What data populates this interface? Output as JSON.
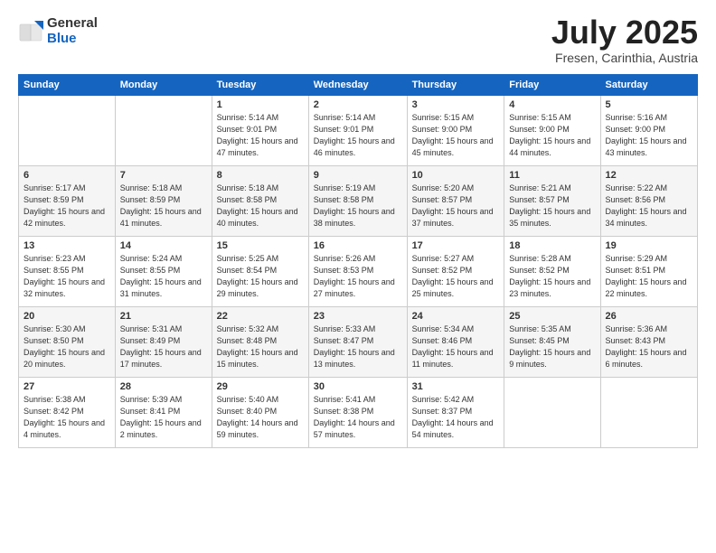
{
  "logo": {
    "general": "General",
    "blue": "Blue"
  },
  "title": "July 2025",
  "subtitle": "Fresen, Carinthia, Austria",
  "days_header": [
    "Sunday",
    "Monday",
    "Tuesday",
    "Wednesday",
    "Thursday",
    "Friday",
    "Saturday"
  ],
  "weeks": [
    [
      {
        "day": "",
        "info": ""
      },
      {
        "day": "",
        "info": ""
      },
      {
        "day": "1",
        "info": "Sunrise: 5:14 AM\nSunset: 9:01 PM\nDaylight: 15 hours\nand 47 minutes."
      },
      {
        "day": "2",
        "info": "Sunrise: 5:14 AM\nSunset: 9:01 PM\nDaylight: 15 hours\nand 46 minutes."
      },
      {
        "day": "3",
        "info": "Sunrise: 5:15 AM\nSunset: 9:00 PM\nDaylight: 15 hours\nand 45 minutes."
      },
      {
        "day": "4",
        "info": "Sunrise: 5:15 AM\nSunset: 9:00 PM\nDaylight: 15 hours\nand 44 minutes."
      },
      {
        "day": "5",
        "info": "Sunrise: 5:16 AM\nSunset: 9:00 PM\nDaylight: 15 hours\nand 43 minutes."
      }
    ],
    [
      {
        "day": "6",
        "info": "Sunrise: 5:17 AM\nSunset: 8:59 PM\nDaylight: 15 hours\nand 42 minutes."
      },
      {
        "day": "7",
        "info": "Sunrise: 5:18 AM\nSunset: 8:59 PM\nDaylight: 15 hours\nand 41 minutes."
      },
      {
        "day": "8",
        "info": "Sunrise: 5:18 AM\nSunset: 8:58 PM\nDaylight: 15 hours\nand 40 minutes."
      },
      {
        "day": "9",
        "info": "Sunrise: 5:19 AM\nSunset: 8:58 PM\nDaylight: 15 hours\nand 38 minutes."
      },
      {
        "day": "10",
        "info": "Sunrise: 5:20 AM\nSunset: 8:57 PM\nDaylight: 15 hours\nand 37 minutes."
      },
      {
        "day": "11",
        "info": "Sunrise: 5:21 AM\nSunset: 8:57 PM\nDaylight: 15 hours\nand 35 minutes."
      },
      {
        "day": "12",
        "info": "Sunrise: 5:22 AM\nSunset: 8:56 PM\nDaylight: 15 hours\nand 34 minutes."
      }
    ],
    [
      {
        "day": "13",
        "info": "Sunrise: 5:23 AM\nSunset: 8:55 PM\nDaylight: 15 hours\nand 32 minutes."
      },
      {
        "day": "14",
        "info": "Sunrise: 5:24 AM\nSunset: 8:55 PM\nDaylight: 15 hours\nand 31 minutes."
      },
      {
        "day": "15",
        "info": "Sunrise: 5:25 AM\nSunset: 8:54 PM\nDaylight: 15 hours\nand 29 minutes."
      },
      {
        "day": "16",
        "info": "Sunrise: 5:26 AM\nSunset: 8:53 PM\nDaylight: 15 hours\nand 27 minutes."
      },
      {
        "day": "17",
        "info": "Sunrise: 5:27 AM\nSunset: 8:52 PM\nDaylight: 15 hours\nand 25 minutes."
      },
      {
        "day": "18",
        "info": "Sunrise: 5:28 AM\nSunset: 8:52 PM\nDaylight: 15 hours\nand 23 minutes."
      },
      {
        "day": "19",
        "info": "Sunrise: 5:29 AM\nSunset: 8:51 PM\nDaylight: 15 hours\nand 22 minutes."
      }
    ],
    [
      {
        "day": "20",
        "info": "Sunrise: 5:30 AM\nSunset: 8:50 PM\nDaylight: 15 hours\nand 20 minutes."
      },
      {
        "day": "21",
        "info": "Sunrise: 5:31 AM\nSunset: 8:49 PM\nDaylight: 15 hours\nand 17 minutes."
      },
      {
        "day": "22",
        "info": "Sunrise: 5:32 AM\nSunset: 8:48 PM\nDaylight: 15 hours\nand 15 minutes."
      },
      {
        "day": "23",
        "info": "Sunrise: 5:33 AM\nSunset: 8:47 PM\nDaylight: 15 hours\nand 13 minutes."
      },
      {
        "day": "24",
        "info": "Sunrise: 5:34 AM\nSunset: 8:46 PM\nDaylight: 15 hours\nand 11 minutes."
      },
      {
        "day": "25",
        "info": "Sunrise: 5:35 AM\nSunset: 8:45 PM\nDaylight: 15 hours\nand 9 minutes."
      },
      {
        "day": "26",
        "info": "Sunrise: 5:36 AM\nSunset: 8:43 PM\nDaylight: 15 hours\nand 6 minutes."
      }
    ],
    [
      {
        "day": "27",
        "info": "Sunrise: 5:38 AM\nSunset: 8:42 PM\nDaylight: 15 hours\nand 4 minutes."
      },
      {
        "day": "28",
        "info": "Sunrise: 5:39 AM\nSunset: 8:41 PM\nDaylight: 15 hours\nand 2 minutes."
      },
      {
        "day": "29",
        "info": "Sunrise: 5:40 AM\nSunset: 8:40 PM\nDaylight: 14 hours\nand 59 minutes."
      },
      {
        "day": "30",
        "info": "Sunrise: 5:41 AM\nSunset: 8:38 PM\nDaylight: 14 hours\nand 57 minutes."
      },
      {
        "day": "31",
        "info": "Sunrise: 5:42 AM\nSunset: 8:37 PM\nDaylight: 14 hours\nand 54 minutes."
      },
      {
        "day": "",
        "info": ""
      },
      {
        "day": "",
        "info": ""
      }
    ]
  ]
}
